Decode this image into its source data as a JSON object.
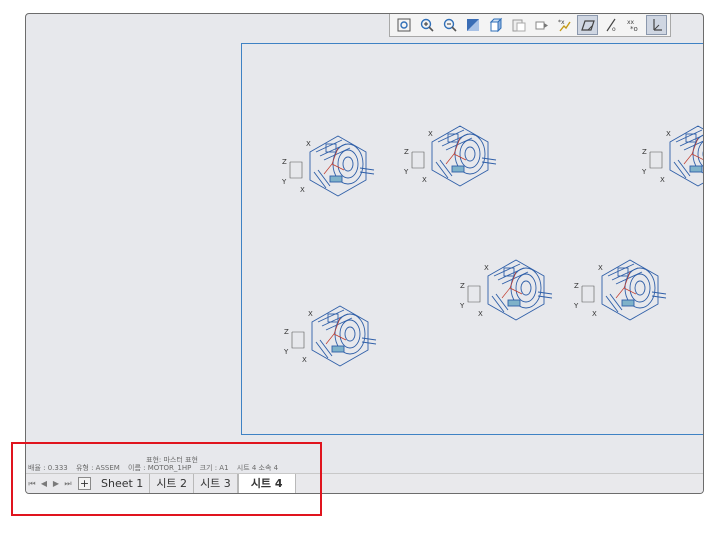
{
  "toolbar": {
    "icons": [
      "zoom-fit-icon",
      "zoom-in-icon",
      "zoom-out-icon",
      "shade-icon",
      "view-3d-icon",
      "paste-icon",
      "section-icon",
      "datum-coords-icon",
      "sketch-plane-icon",
      "datum-axis-icon",
      "point-display-icon",
      "csys-display-icon"
    ],
    "active_icons": [
      "sketch-plane-icon",
      "csys-display-icon"
    ]
  },
  "status": {
    "display_label": "표현: 마스터 표현",
    "scale": "배율 : 0.333",
    "type": "유형 : ASSEM",
    "name": "이름 : MOTOR_1HP",
    "size": "크기 : A1",
    "sheet": "시트 4 소속 4"
  },
  "sheet_tabs": {
    "nav": [
      "⏮",
      "◀",
      "▶",
      "⏭"
    ],
    "add_label": "+",
    "tabs": [
      {
        "label": "Sheet 1",
        "active": false
      },
      {
        "label": "시트 2",
        "active": false
      },
      {
        "label": "시트 3",
        "active": false
      },
      {
        "label": "시트 4",
        "active": true
      }
    ]
  },
  "drawing": {
    "views": 6,
    "csys_axis_labels": [
      "Z",
      "Y",
      "X"
    ],
    "model_color": "#2f5fa8",
    "frame_color": "#3f82c4",
    "highlight_color": "#e0141e"
  }
}
